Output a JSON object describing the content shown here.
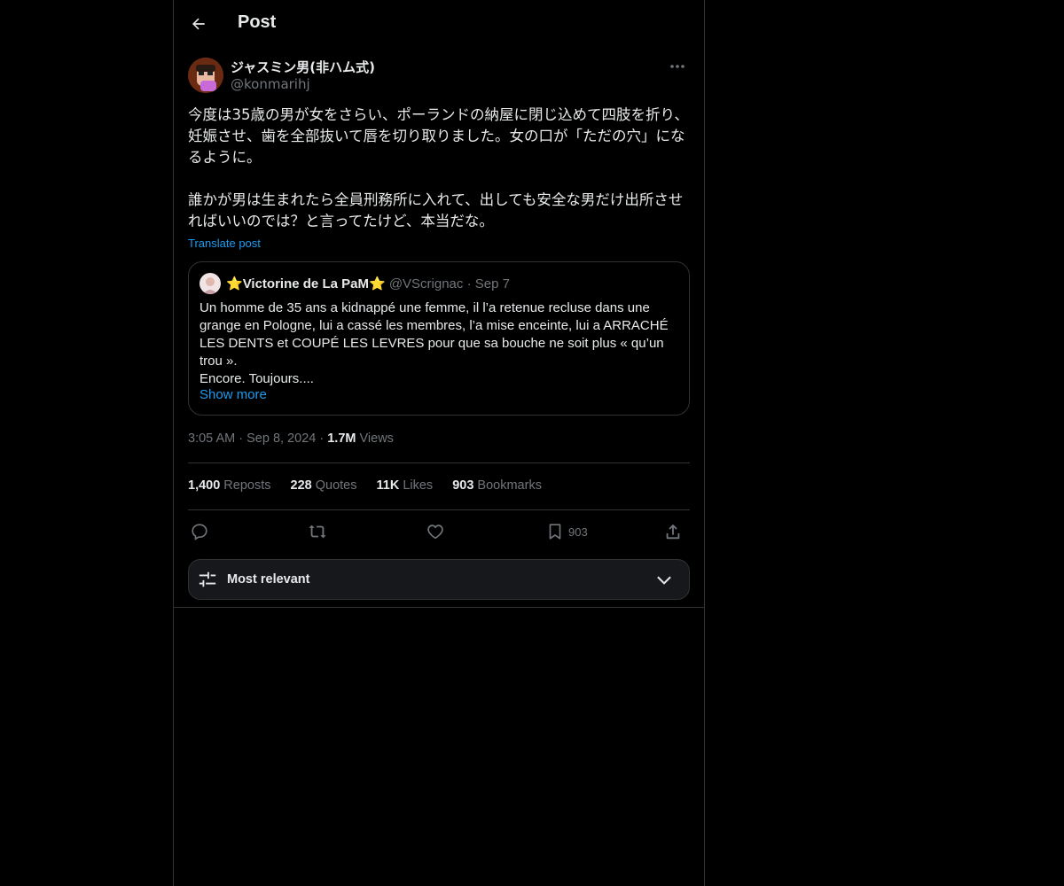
{
  "header": {
    "title": "Post"
  },
  "author": {
    "name": "ジャスミン男(非ハム式)",
    "handle": "@konmarihj"
  },
  "post": {
    "text": "今度は35歳の男が女をさらい、ポーランドの納屋に閉じ込めて四肢を折り、妊娠させ、歯を全部抜いて唇を切り取りました。女の口が「ただの穴」になるように。\n\n誰かが男は生まれたら全員刑務所に入れて、出しても安全な男だけ出所させればいいのでは？と言ってたけど、本当だな。",
    "translate_label": "Translate post",
    "time": "3:05 AM",
    "date": "Sep 8, 2024",
    "views_count": "1.7M",
    "views_label": "Views"
  },
  "quote": {
    "name": "Victorine de La PaM",
    "star": "⭐",
    "handle": "@VScrignac",
    "sep": "·",
    "date": "Sep 7",
    "text": "Un homme de 35 ans a kidnappé une femme, il l’a retenue recluse dans une grange en Pologne, lui a cassé les membres, l’a mise enceinte, lui a ARRACHÉ LES DENTS et COUPÉ LES LEVRES pour que sa bouche ne soit plus « qu’un trou ».\nEncore. Toujours....",
    "show_more": "Show more"
  },
  "meta_sep": "·",
  "stats": {
    "reposts_count": "1,400",
    "reposts_label": "Reposts",
    "quotes_count": "228",
    "quotes_label": "Quotes",
    "likes_count": "11K",
    "likes_label": "Likes",
    "bookmarks_count": "903",
    "bookmarks_label": "Bookmarks"
  },
  "actions": {
    "bookmark_count": "903"
  },
  "icons": [
    "back-arrow-icon",
    "more-icon",
    "reply-icon",
    "repost-icon",
    "like-icon",
    "bookmark-icon",
    "share-icon",
    "sliders-icon",
    "chevron-down-icon"
  ],
  "colors": {
    "accent": "#1d9bf0",
    "background": "#000000",
    "border": "#2f3336",
    "muted": "#71767b",
    "text": "#e7e9ea",
    "star": "#f5b82e"
  },
  "sort": {
    "label": "Most relevant"
  }
}
